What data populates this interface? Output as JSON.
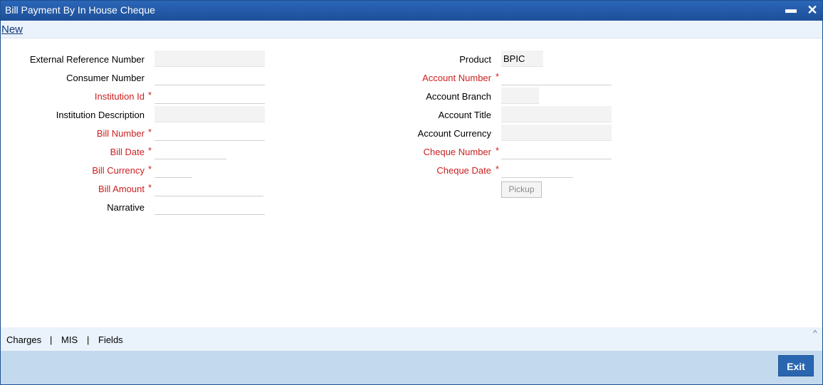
{
  "window": {
    "title": "Bill Payment By In House Cheque",
    "minimize_glyph": "▬",
    "close_glyph": "✕"
  },
  "menu": {
    "new_label": "New"
  },
  "required_marker": "*",
  "left_fields": {
    "external_reference_number": {
      "label": "External Reference Number",
      "value": ""
    },
    "consumer_number": {
      "label": "Consumer Number",
      "value": ""
    },
    "institution_id": {
      "label": "Institution Id",
      "value": ""
    },
    "institution_description": {
      "label": "Institution Description",
      "value": ""
    },
    "bill_number": {
      "label": "Bill Number",
      "value": ""
    },
    "bill_date": {
      "label": "Bill Date",
      "value": ""
    },
    "bill_currency": {
      "label": "Bill Currency",
      "value": ""
    },
    "bill_amount": {
      "label": "Bill Amount",
      "value": ""
    },
    "narrative": {
      "label": "Narrative",
      "value": ""
    }
  },
  "right_fields": {
    "product": {
      "label": "Product",
      "value": "BPIC"
    },
    "account_number": {
      "label": "Account Number",
      "value": ""
    },
    "account_branch": {
      "label": "Account Branch",
      "value": ""
    },
    "account_title": {
      "label": "Account Title",
      "value": ""
    },
    "account_currency": {
      "label": "Account Currency",
      "value": ""
    },
    "cheque_number": {
      "label": "Cheque Number",
      "value": ""
    },
    "cheque_date": {
      "label": "Cheque Date",
      "value": ""
    }
  },
  "pickup_label": "Pickup",
  "tabs": {
    "charges": "Charges",
    "mis": "MIS",
    "fields": "Fields",
    "separator": "|",
    "collapse_glyph": "^"
  },
  "footer": {
    "exit_label": "Exit"
  },
  "colors": {
    "title_bar": "#2a66b8",
    "required_label": "#cc1f1f",
    "footer_bg": "#c2d9ee",
    "exit_button": "#2a66b0"
  }
}
